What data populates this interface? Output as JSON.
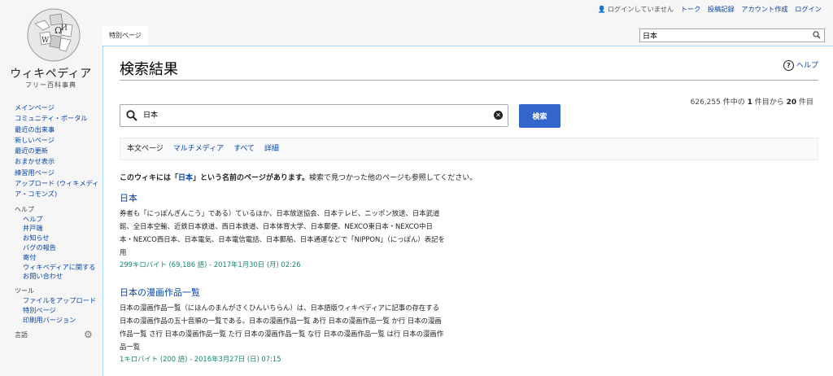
{
  "logo": {
    "name": "ウィキペディア",
    "tagline": "フリー百科事典"
  },
  "personal": {
    "anon": "ログインしていません",
    "talk": "トーク",
    "contributions": "投稿記録",
    "create_account": "アカウント作成",
    "login": "ログイン"
  },
  "tabs": {
    "special": "特別ページ"
  },
  "top_search": {
    "value": "日本"
  },
  "sidebar": {
    "nav": [
      "メインページ",
      "コミュニティ・ポータル",
      "最近の出来事",
      "新しいページ",
      "最近の更新",
      "おまかせ表示",
      "練習用ページ",
      "アップロード (ウィキメディア・コモンズ)"
    ],
    "help_heading": "ヘルプ",
    "help": [
      "ヘルプ",
      "井戸端",
      "お知らせ",
      "バグの報告",
      "寄付",
      "ウィキペディアに関するお問い合わせ"
    ],
    "tools_heading": "ツール",
    "tools": [
      "ファイルをアップロード",
      "特別ページ",
      "印刷用バージョン"
    ],
    "languages_heading": "言語"
  },
  "page": {
    "title": "検索結果",
    "help_link": "ヘルプ",
    "count": {
      "total": "626,255",
      "mid1": " 件中の ",
      "from": "1",
      "mid2": " 件目から ",
      "to": "20",
      "end": " 件目"
    },
    "search_value": "日本",
    "search_button": "検索",
    "profiles": [
      "本文ページ",
      "マルチメディア",
      "すべて",
      "詳細"
    ],
    "did_you": {
      "pre": "このウィキには「",
      "link": "日本",
      "post": "」という名前のページがあります。",
      "rest": "検索で見つかった他のページも参照してください。"
    }
  },
  "results": [
    {
      "title": "日本",
      "snippet": "券者も「にっぽんぎんこう」である）ているほか、日本放送協会、日本テレビ、ニッポン放送、日本武道館、全日本空輸、近鉄日本鉄道、西日本鉄道、日本体育大学、日本郵便、NEXCO東日本・NEXCO中日本・NEXCO西日本、日本電気、日本電信電話、日本郵船、日本通運などで「NIPPON」（にっぽん）表記を用",
      "meta": "299キロバイト (69,186 語) - 2017年1月30日 (月) 02:26"
    },
    {
      "title": "日本の漫画作品一覧",
      "snippet": "日本の漫画作品一覧（にほんのまんがさくひんいちらん）は、日本語版ウィキペディアに記事の存在する日本の漫画作品の五十音順の一覧である。日本の漫画作品一覧 あ行 日本の漫画作品一覧 か行 日本の漫画作品一覧 さ行 日本の漫画作品一覧 た行 日本の漫画作品一覧 な行 日本の漫画作品一覧 は行 日本の漫画作品一覧",
      "meta": "1キロバイト (200 語) - 2016年3月27日 (日) 07:15"
    }
  ]
}
